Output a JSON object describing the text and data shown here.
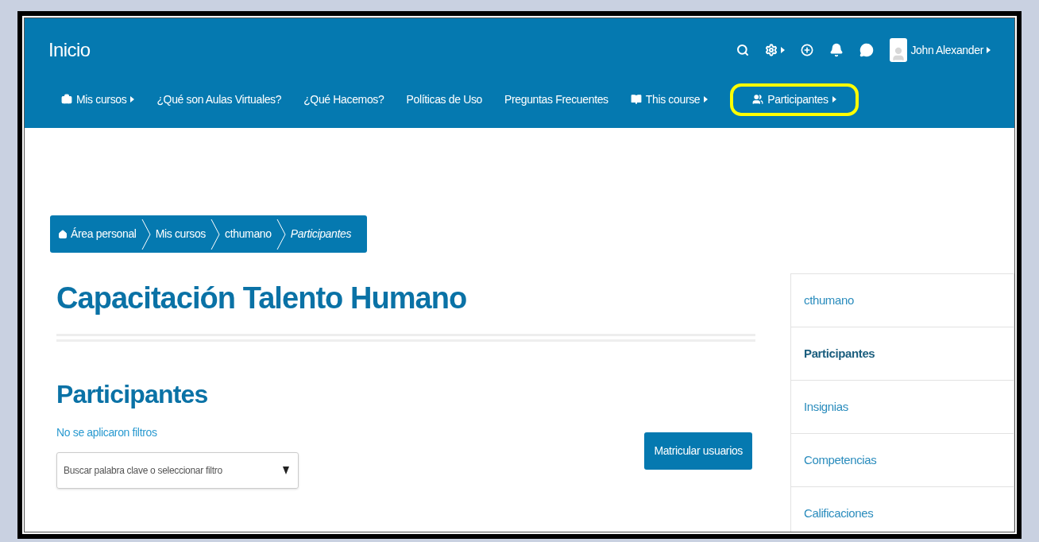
{
  "header": {
    "brand": "Inicio",
    "user_name": "John Alexander"
  },
  "nav": [
    {
      "label": "Mis cursos",
      "kind": "menu",
      "highlighted": false
    },
    {
      "label": "¿Qué son Aulas Virtuales?",
      "kind": "link",
      "highlighted": false
    },
    {
      "label": "¿Qué Hacemos?",
      "kind": "link",
      "highlighted": false
    },
    {
      "label": "Políticas de Uso",
      "kind": "link",
      "highlighted": false
    },
    {
      "label": "Preguntas Frecuentes",
      "kind": "link",
      "highlighted": false
    },
    {
      "label": "This course",
      "kind": "menu",
      "highlighted": false
    },
    {
      "label": "Participantes",
      "kind": "menu",
      "highlighted": true
    }
  ],
  "breadcrumb": [
    "Área personal",
    "Mis cursos",
    "cthumano",
    "Participantes"
  ],
  "course_title": "Capacitación Talento Humano",
  "section_title": "Participantes",
  "filter_status": "No se aplicaron filtros",
  "search": {
    "placeholder": "Buscar palabra clave o seleccionar filtro"
  },
  "enrol_button": "Matricular usuarios",
  "sidebar": {
    "items": [
      {
        "label": "cthumano",
        "selected": false
      },
      {
        "label": "Participantes",
        "selected": true
      },
      {
        "label": "Insignias",
        "selected": false
      },
      {
        "label": "Competencias",
        "selected": false
      },
      {
        "label": "Calificaciones",
        "selected": false
      }
    ]
  }
}
